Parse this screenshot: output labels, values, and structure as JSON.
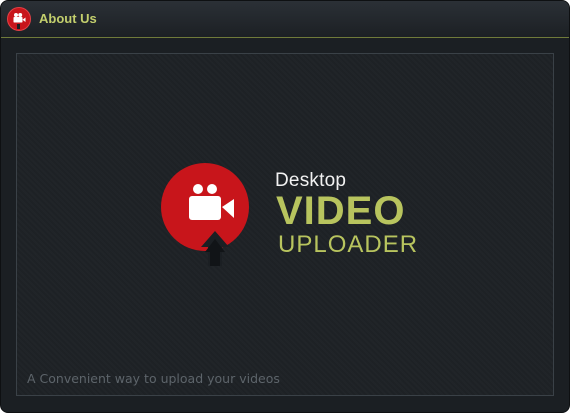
{
  "window": {
    "title": "About Us"
  },
  "logo": {
    "line1": "Desktop",
    "line2": "VIDEO",
    "line3": "UPLOADER",
    "icon": "camera-upload-icon"
  },
  "tagline": "A Convenient way to upload your videos",
  "colors": {
    "accent": "#b8c45e",
    "brand_red": "#c8151b",
    "background": "#1e2226"
  }
}
